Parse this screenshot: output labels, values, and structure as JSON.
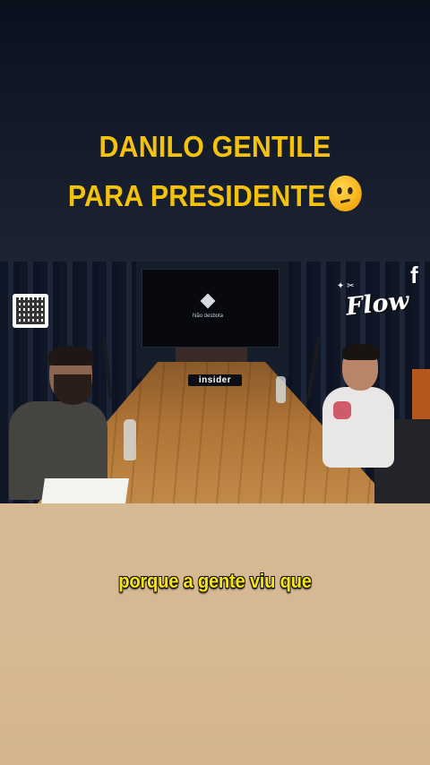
{
  "headline": {
    "line1": "DANILO GENTILE",
    "line2": "PARA PRESIDENTE",
    "emoji": "thinking-face"
  },
  "video": {
    "tv_caption": "Não desbota",
    "table_sign": "insider",
    "logo_text": "Flow",
    "corner_glyph": "f"
  },
  "subtitle": "porque a gente viu que",
  "colors": {
    "headline": "#f4c20d",
    "subtitle": "#f6e41a",
    "top_background": "#0c1220",
    "bottom_background": "#d6b891"
  }
}
